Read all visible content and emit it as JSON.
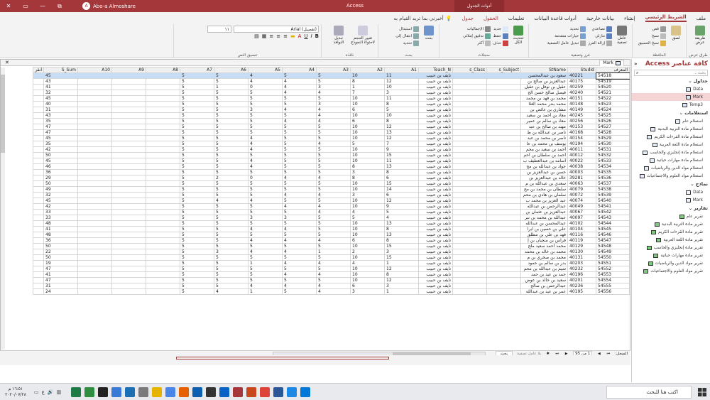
{
  "window": {
    "user": "Abo-a Almoshare",
    "app_name": "Access",
    "context_label": "أدوات الجدول",
    "controls": [
      "✕",
      "▭",
      "—",
      "⧉"
    ]
  },
  "tabs": [
    "ملف",
    "الشريط الرئيسي",
    "إنشاء",
    "بيانات خارجية",
    "أدوات قاعدة البيانات",
    "تعليمات",
    "الحقول",
    "جدول"
  ],
  "tell_me": "أخبرني بما تريد القيام به",
  "ribbon": {
    "groups": [
      {
        "label": "طرق عرض",
        "items": [
          "طريقة عرض"
        ]
      },
      {
        "label": "الحافظة",
        "items": [
          "لصق",
          "قص",
          "نسخ",
          "نسخ التنسيق"
        ]
      },
      {
        "label": "فرز وتصفية",
        "items": [
          "عامل تصفية",
          "تصاعدي",
          "تنازلي",
          "إزالة الفرز",
          "تحديد",
          "خيارات متقدمة",
          "تبديل عامل التصفية"
        ]
      },
      {
        "label": "سجلات",
        "items": [
          "تحديث الكل",
          "جديد",
          "حفظ",
          "حذف",
          "الإجماليات",
          "تدقيق إملائي",
          "أكثر"
        ]
      },
      {
        "label": "بحث",
        "items": [
          "بحث",
          "استبدال",
          "انتقال إلى",
          "تحديد"
        ]
      },
      {
        "label": "نافذة",
        "items": [
          "تغيير الحجم لاحتواء النموذج",
          "تبديل النوافذ"
        ]
      },
      {
        "label": "تنسيق النص",
        "font": "(تفصيل) Arial",
        "size": "١١"
      }
    ]
  },
  "nav": {
    "title": "كافة عناصر Access",
    "search_placeholder": "بحث...",
    "sections": [
      {
        "name": "جداول",
        "items": [
          {
            "label": "Data",
            "type": "table"
          },
          {
            "label": "Mark",
            "type": "table",
            "selected": true
          },
          {
            "label": "Temp3",
            "type": "table"
          }
        ]
      },
      {
        "name": "استعلامات",
        "items": [
          {
            "label": "استعلام عام",
            "type": "query"
          },
          {
            "label": "استعلام مادة التربية البدنية",
            "type": "query"
          },
          {
            "label": "استعلام مادة القرءات الكريم",
            "type": "query"
          },
          {
            "label": "استعلام مادة اللغة العربية",
            "type": "query"
          },
          {
            "label": "استعلام مادة إنجليزي والحاسب",
            "type": "query"
          },
          {
            "label": "استعلام مادة مهارات حياتية",
            "type": "query"
          },
          {
            "label": "استعلام مواد الدين والرياضيات",
            "type": "query"
          },
          {
            "label": "استعلام مواد العلوم والاجتماعيات",
            "type": "query"
          }
        ]
      },
      {
        "name": "نماذج",
        "items": [
          {
            "label": "Data",
            "type": "form"
          },
          {
            "label": "Mark",
            "type": "form"
          }
        ]
      },
      {
        "name": "تقارير",
        "items": [
          {
            "label": "تقرير عام",
            "type": "report"
          },
          {
            "label": "تقرير مادة التربية البدنية",
            "type": "report"
          },
          {
            "label": "تقرير مادة القرءات الكريم",
            "type": "report"
          },
          {
            "label": "تقرير مادة اللغة العربية",
            "type": "report"
          },
          {
            "label": "تقرير مادة إنجليزي والحاسب",
            "type": "report"
          },
          {
            "label": "تقرير مادة مهارات حياتية",
            "type": "report"
          },
          {
            "label": "تقرير مواد الدين والرياضيات",
            "type": "report"
          },
          {
            "label": "تقرير مواد العلوم والاجتماعيات",
            "type": "report"
          }
        ]
      }
    ]
  },
  "doc_tab": "Mark",
  "columns": [
    "المعرف",
    "StudId",
    "StName",
    "s_Subject",
    "s_Class",
    "Teach_N",
    "A1",
    "A2",
    "A3",
    "A4",
    "A5",
    "A6",
    "A7",
    "A8",
    "A9",
    "A10",
    "S_Sum",
    "أنقر"
  ],
  "rows": [
    [
      "54518",
      "40221",
      "سعود بن عبدالمحسن",
      "",
      "",
      "نايف بن حبيب",
      "11",
      "10",
      "5",
      "5",
      "4",
      "5",
      "5",
      "",
      "",
      "",
      "45"
    ],
    [
      "54519",
      "40175",
      "عبدالعزيز بن صالح بن",
      "",
      "",
      "نايف بن حبيب",
      "12",
      "8",
      "5",
      "4",
      "4",
      "5",
      "5",
      "",
      "",
      "",
      "43"
    ],
    [
      "54520",
      "40259",
      "عقيل بن نوفل بن عقيل",
      "",
      "",
      "نايف بن حبيب",
      "10",
      "1",
      "3",
      "4",
      "0",
      "1",
      "5",
      "",
      "",
      "",
      "41"
    ],
    [
      "54521",
      "40240",
      "فيصل صالح حسن الح",
      "",
      "",
      "نايف بن حبيب",
      "3",
      "7",
      "4",
      "4",
      "5",
      "5",
      "5",
      "",
      "",
      "",
      "32"
    ],
    [
      "54522",
      "40151",
      "محمد بن فهد بن محمد",
      "",
      "",
      "نايف بن حبيب",
      "11",
      "10",
      "5",
      "5",
      "5",
      "5",
      "5",
      "",
      "",
      "",
      "45"
    ],
    [
      "54523",
      "40148",
      "محمد بندر محمد الغلا",
      "",
      "",
      "نايف بن حبيب",
      "8",
      "10",
      "3",
      "5",
      "5",
      "5",
      "5",
      "",
      "",
      "",
      "40"
    ],
    [
      "54524",
      "40149",
      "مشاري بن عائض بن",
      "",
      "",
      "نايف بن حبيب",
      "5",
      "6",
      "4",
      "4",
      "3",
      "5",
      "5",
      "",
      "",
      "",
      "31"
    ],
    [
      "54525",
      "40245",
      "معاذ بن أحمد بن سعيد",
      "",
      "",
      "نايف بن حبيب",
      "10",
      "10",
      "4",
      "5",
      "5",
      "5",
      "5",
      "",
      "",
      "",
      "43"
    ],
    [
      "54526",
      "40256",
      "معاذ بن سالم بن عمير",
      "",
      "",
      "نايف بن حبيب",
      "8",
      "6",
      "4",
      "4",
      "5",
      "5",
      "5",
      "",
      "",
      "",
      "35"
    ],
    [
      "54527",
      "40153",
      "مهند بن صالح بن عبد",
      "",
      "",
      "نايف بن حبيب",
      "12",
      "10",
      "5",
      "5",
      "5",
      "5",
      "5",
      "",
      "",
      "",
      "47"
    ],
    [
      "54528",
      "40168",
      "ناصر بن عبدالله بن ط",
      "",
      "",
      "نايف بن حبيب",
      "13",
      "10",
      "5",
      "5",
      "5",
      "5",
      "5",
      "",
      "",
      "",
      "47"
    ],
    [
      "54529",
      "40154",
      "ناصر بن محمد بن عبد",
      "",
      "",
      "نايف بن حبيب",
      "12",
      "10",
      "5",
      "5",
      "4",
      "5",
      "5",
      "",
      "",
      "",
      "45"
    ],
    [
      "54530",
      "40194",
      "يوسف بن محمد بن عا",
      "",
      "",
      "نايف بن حبيب",
      "7",
      "5",
      "4",
      "5",
      "4",
      "5",
      "5",
      "",
      "",
      "",
      "35"
    ],
    [
      "54531",
      "40011",
      "أحمد بن سعيد بن محم",
      "",
      "",
      "نايف بن حبيب",
      "9",
      "10",
      "5",
      "5",
      "4",
      "5",
      "5",
      "",
      "",
      "",
      "42"
    ],
    [
      "54532",
      "40012",
      "أحمد بن سلطان بن أحم",
      "",
      "",
      "نايف بن حبيب",
      "15",
      "10",
      "5",
      "5",
      "5",
      "5",
      "5",
      "",
      "",
      "",
      "50"
    ],
    [
      "54533",
      "40022",
      "أسامه بن عبدالعطيف ب",
      "",
      "",
      "نايف بن حبيب",
      "11",
      "10",
      "5",
      "5",
      "4",
      "5",
      "5",
      "",
      "",
      "",
      "45"
    ],
    [
      "54534",
      "40038",
      "جواد بن عبدالله بن مح",
      "",
      "",
      "نايف بن حبيب",
      "13",
      "8",
      "5",
      "5",
      "4",
      "5",
      "5",
      "",
      "",
      "",
      "46"
    ],
    [
      "54535",
      "40003",
      "حسن بن عبدالعزيز بن",
      "",
      "",
      "نايف بن حبيب",
      "8",
      "3",
      "5",
      "5",
      "5",
      "5",
      "5",
      "",
      "",
      "",
      "36"
    ],
    [
      "54536",
      "39281",
      "خالد بن عبدالعزيز بن",
      "",
      "",
      "نايف بن حبيب",
      "6",
      "8",
      "4",
      "4",
      "0",
      "2",
      "5",
      "",
      "",
      "",
      "29"
    ],
    [
      "54537",
      "40063",
      "سعدي بن عبدالله بن م",
      "",
      "",
      "نايف بن حبيب",
      "15",
      "10",
      "5",
      "5",
      "5",
      "5",
      "5",
      "",
      "",
      "",
      "50"
    ],
    [
      "54538",
      "40079",
      "سلطان بن محمد بن مح",
      "",
      "",
      "نايف بن حبيب",
      "14",
      "10",
      "5",
      "5",
      "5",
      "5",
      "5",
      "",
      "",
      "",
      "49"
    ],
    [
      "54539",
      "40072",
      "سلمان بن هادي بن محم",
      "",
      "",
      "نايف بن حبيب",
      "6",
      "3",
      "4",
      "4",
      "5",
      "5",
      "5",
      "",
      "",
      "",
      "32"
    ],
    [
      "54540",
      "40074",
      "عبد العزيز بن محمد ب",
      "",
      "",
      "نايف بن حبيب",
      "12",
      "10",
      "5",
      "5",
      "4",
      "4",
      "5",
      "",
      "",
      "",
      "45"
    ],
    [
      "54541",
      "40049",
      "عبدالرحمن بن عبدالله",
      "",
      "",
      "نايف بن حبيب",
      "9",
      "10",
      "4",
      "4",
      "5",
      "5",
      "5",
      "",
      "",
      "",
      "42"
    ],
    [
      "54542",
      "40067",
      "عبدالعزيز بن عثمان بن",
      "",
      "",
      "نايف بن حبيب",
      "5",
      "4",
      "4",
      "5",
      "5",
      "5",
      "5",
      "",
      "",
      "",
      "33"
    ],
    [
      "54543",
      "40097",
      "عبدالله بن محمد بن نبر",
      "",
      "",
      "نايف بن حبيب",
      "4",
      "5",
      "5",
      "3",
      "3",
      "5",
      "5",
      "",
      "",
      "",
      "33"
    ],
    [
      "54544",
      "40102",
      "عبدالمحسن بن عبدالله",
      "",
      "",
      "نايف بن حبيب",
      "13",
      "10",
      "5",
      "5",
      "5",
      "5",
      "5",
      "",
      "",
      "",
      "48"
    ],
    [
      "54545",
      "40104",
      "علي بن حسين بن ابرا",
      "",
      "",
      "نايف بن حبيب",
      "8",
      "10",
      "5",
      "4",
      "4",
      "5",
      "5",
      "",
      "",
      "",
      "41"
    ],
    [
      "54546",
      "40116",
      "فهد بن علي بن مطلق",
      "",
      "",
      "نايف بن حبيب",
      "13",
      "10",
      "5",
      "5",
      "5",
      "5",
      "5",
      "",
      "",
      "",
      "48"
    ],
    [
      "54547",
      "40119",
      "فراس بن منجيان بن إ",
      "",
      "",
      "نايف بن حبيب",
      "8",
      "6",
      "4",
      "4",
      "4",
      "5",
      "5",
      "",
      "",
      "",
      "36"
    ],
    [
      "54548",
      "40129",
      "محمد أحمد سعيد ملح",
      "",
      "",
      "نايف بن حبيب",
      "15",
      "10",
      "5",
      "5",
      "5",
      "5",
      "5",
      "",
      "",
      "",
      "50"
    ],
    [
      "54549",
      "40130",
      "محمد بن خالد بن محمد",
      "",
      "",
      "نايف بن حبيب",
      "3",
      "2",
      "1",
      "4",
      "4",
      "3",
      "5",
      "",
      "",
      "",
      "22"
    ],
    [
      "54550",
      "40131",
      "محمد بن صخري بن م",
      "",
      "",
      "نايف بن حبيب",
      "15",
      "10",
      "5",
      "5",
      "5",
      "5",
      "5",
      "",
      "",
      "",
      "50"
    ],
    [
      "54551",
      "40203",
      "بدر بن سالم بن حمود",
      "",
      "",
      "نايف بن حبيب",
      "1",
      "4",
      "4",
      "4",
      "1",
      "5",
      "5",
      "",
      "",
      "",
      "19"
    ],
    [
      "54552",
      "40232",
      "تميم بن عبدالله بن محم",
      "",
      "",
      "نايف بن حبيب",
      "12",
      "10",
      "5",
      "5",
      "5",
      "5",
      "5",
      "",
      "",
      "",
      "47"
    ],
    [
      "54553",
      "40196",
      "حمد بن عيد بن حمد",
      "",
      "",
      "نايف بن حبيب",
      "8",
      "10",
      "4",
      "4",
      "5",
      "5",
      "5",
      "",
      "",
      "",
      "41"
    ],
    [
      "54554",
      "40201",
      "سعيد بن خالد بن عوض",
      "",
      "",
      "نايف بن حبيب",
      "12",
      "10",
      "5",
      "5",
      "5",
      "5",
      "5",
      "",
      "",
      "",
      "47"
    ],
    [
      "54555",
      "40236",
      "عبدالرحمن بن صالح",
      "",
      "",
      "نايف بن حبيب",
      "3",
      "6",
      "4",
      "4",
      "4",
      "5",
      "5",
      "",
      "",
      "",
      "31"
    ],
    [
      "54556",
      "40195",
      "عمر بن عيد بن عبدالله",
      "",
      "",
      "نايف بن حبيب",
      "1",
      "3",
      "4",
      "5",
      "1",
      "4",
      "5",
      "",
      "",
      "",
      "24"
    ]
  ],
  "record_nav": {
    "label": "السجل:",
    "position": "1 من 95",
    "filter": "بلا عامل تصفية",
    "search": "بحث"
  },
  "taskbar": {
    "search_placeholder": "اكتب هنا للبحث",
    "time": "١٦:٥١ م",
    "date": "٢٠٢٠/٠٧/٢٨"
  },
  "colors": {
    "accent": "#a4373a",
    "selection": "#c7dcf5"
  }
}
